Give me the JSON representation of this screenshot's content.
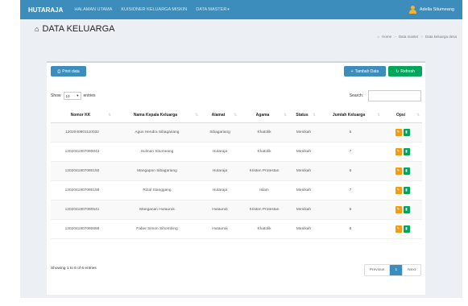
{
  "navbar": {
    "brand": "HUTARAJA",
    "links": [
      "HALAMAN UTAMA",
      "KUISIONER KELUARGA MISKIN",
      "DATA MASTER"
    ],
    "user_name": "Adella Situmeang"
  },
  "header": {
    "title": "DATA KELUARGA",
    "breadcrumb": [
      "Home",
      "Data master",
      "Data keluarga desa"
    ]
  },
  "toolbar": {
    "print_label": "Print data",
    "add_label": "Tambah Data",
    "refresh_label": "Refresh"
  },
  "controls": {
    "show_label": "Show",
    "length_value": "10",
    "entries_label": "entries",
    "search_label": "Search:"
  },
  "table": {
    "columns": [
      "Nomor KK",
      "Nama Kepala Keluarga",
      "Alamat",
      "Agama",
      "Status",
      "Jumlah Keluarga",
      "Opsi"
    ],
    "rows": [
      [
        "1202040801110032",
        "Agus Hendra Sibagariang",
        "Sibagariang",
        "Khatolik",
        "Menikah",
        "5"
      ],
      [
        "1202041807080043",
        "Sulman Situmeang",
        "Hutaraja",
        "Khatolik",
        "Menikah",
        "7"
      ],
      [
        "1202041807080150",
        "Mangapon Sibagariang",
        "Hutaraja",
        "Kristen Protestan",
        "Menikah",
        "6"
      ],
      [
        "1202041807080158",
        "Rizal Stanggang",
        "Hutaraja",
        "Islam",
        "Menikah",
        "7"
      ],
      [
        "1202041807080541",
        "Manganan Hutauruk",
        "Hutauruk",
        "Kristen Protestan",
        "Menikah",
        "6"
      ],
      [
        "1202041807080658",
        "Faber Simon Sihombing",
        "Hutauruk",
        "Khatolik",
        "Menikah",
        "8"
      ]
    ]
  },
  "footer": {
    "info": "Showing 1 to 6 of 6 entries",
    "previous": "Previous",
    "current_page": "1",
    "next": "Next"
  },
  "colors": {
    "primary": "#3c8dbc",
    "success": "#00a65a",
    "warning": "#f39c12",
    "background": "#ecf0f5"
  }
}
